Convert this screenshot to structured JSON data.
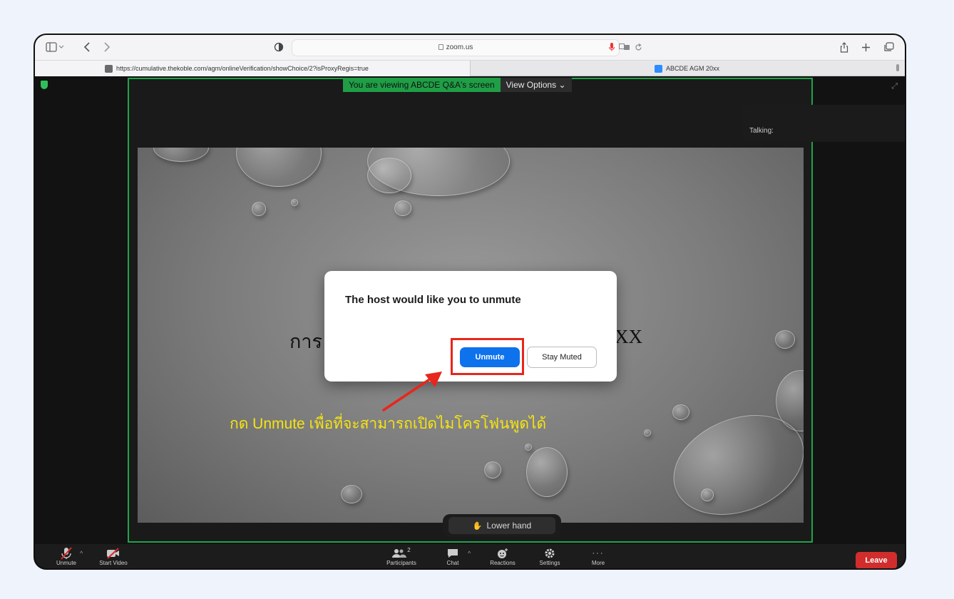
{
  "browser": {
    "address_host": "zoom.us",
    "tabs": [
      {
        "title": "https://cumulative.thekoble.com/agm/onlineVerification/showChoice/2?isProxyRegis=true",
        "active": true
      },
      {
        "title": "ABCDE AGM 20xx",
        "active": false
      }
    ],
    "icons": [
      "sidebar-icon",
      "back-icon",
      "forward-icon",
      "privacy-icon",
      "lock-icon",
      "mic-icon",
      "translate-icon",
      "reload-icon",
      "share-icon",
      "new-tab-icon",
      "tabs-overview-icon"
    ]
  },
  "meeting": {
    "share_banner": "You are viewing ABCDE Q&A's screen",
    "view_options": "View Options",
    "talking_label": "Talking:",
    "slide_text_left": "การ",
    "slide_text_right": "XX",
    "lower_hand": "Lower hand",
    "colors": {
      "share_border": "#21a34a",
      "unmute_button": "#0e72ed",
      "leave": "#d12d2d",
      "annotation_red": "#e8261b",
      "annotation_yellow": "#f5e313"
    }
  },
  "dialog": {
    "title": "The host would like you to unmute",
    "unmute_label": "Unmute",
    "stay_muted_label": "Stay Muted"
  },
  "annotation": {
    "caption": "กด Unmute เพื่อที่จะสามารถเปิดไมโครโฟนพูดได้"
  },
  "controls": {
    "items": [
      {
        "label": "Unmute",
        "icon": "mic-muted-icon"
      },
      {
        "label": "Start Video",
        "icon": "video-off-icon"
      },
      {
        "label": "Participants",
        "icon": "participants-icon",
        "badge": "2"
      },
      {
        "label": "Chat",
        "icon": "chat-icon"
      },
      {
        "label": "Reactions",
        "icon": "reactions-icon"
      },
      {
        "label": "Settings",
        "icon": "settings-icon"
      },
      {
        "label": "More",
        "icon": "more-icon"
      }
    ],
    "leave_label": "Leave"
  }
}
